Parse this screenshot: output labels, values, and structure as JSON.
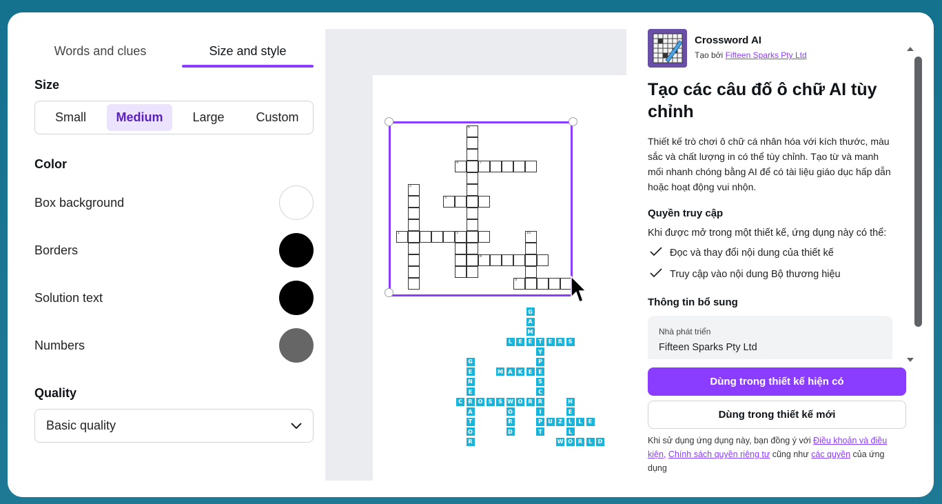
{
  "left_panel": {
    "tabs": [
      {
        "label": "Words and clues",
        "active": false
      },
      {
        "label": "Size and style",
        "active": true
      }
    ],
    "size": {
      "title": "Size",
      "options": [
        "Small",
        "Medium",
        "Large",
        "Custom"
      ],
      "selected": "Medium"
    },
    "color": {
      "title": "Color",
      "rows": [
        {
          "label": "Box background",
          "color": "#ffffff"
        },
        {
          "label": "Borders",
          "color": "#000000"
        },
        {
          "label": "Solution text",
          "color": "#000000"
        },
        {
          "label": "Numbers",
          "color": "#666666"
        }
      ]
    },
    "quality": {
      "title": "Quality",
      "selected": "Basic quality"
    }
  },
  "preview": {
    "crossword_numbers": [
      "1",
      "2",
      "3",
      "4",
      "5",
      "6",
      "7",
      "8",
      "9",
      "10"
    ],
    "logo_words": [
      "GAME",
      "LETTERS",
      "TYPESCRIPT",
      "MAKER",
      "GENERATOR",
      "CROSSWORD",
      "WORD",
      "HELL",
      "PUZZLE",
      "WORLD"
    ]
  },
  "app": {
    "name": "Crossword AI",
    "by_prefix": "Tạo bởi",
    "developer_link": "Fifteen Sparks Pty Ltd",
    "headline": "Tạo các câu đố ô chữ AI tùy chỉnh",
    "description": "Thiết kế trò chơi ô chữ cá nhân hóa với kích thước, màu sắc và chất lượng in có thể tùy chỉnh. Tạo từ và manh mối nhanh chóng bằng AI để có tài liệu giáo dục hấp dẫn hoặc hoạt động vui nhộn.",
    "access_title": "Quyền truy cập",
    "access_intro": "Khi được mở trong một thiết kế, ứng dụng này có thể:",
    "permissions": [
      "Đọc và thay đổi nội dung của thiết kế",
      "Truy cập vào nội dung Bộ thương hiệu"
    ],
    "extra_title": "Thông tin bổ sung",
    "developer_label": "Nhà phát triển",
    "developer_value": "Fifteen Sparks Pty Ltd",
    "btn_use_existing": "Dùng trong thiết kế hiện có",
    "btn_use_new": "Dùng trong thiết kế mới",
    "legal": {
      "prefix": "Khi sử dụng ứng dụng này, bạn đồng ý với",
      "terms": "Điều khoản và điều kiện,",
      "privacy": "Chính sách quyền riêng tư",
      "middle": "cũng như",
      "rights": "các quyền",
      "suffix": "của ứng dụng"
    }
  },
  "colors": {
    "accent": "#8b3dff",
    "logo_cyan": "#1ab4da"
  }
}
